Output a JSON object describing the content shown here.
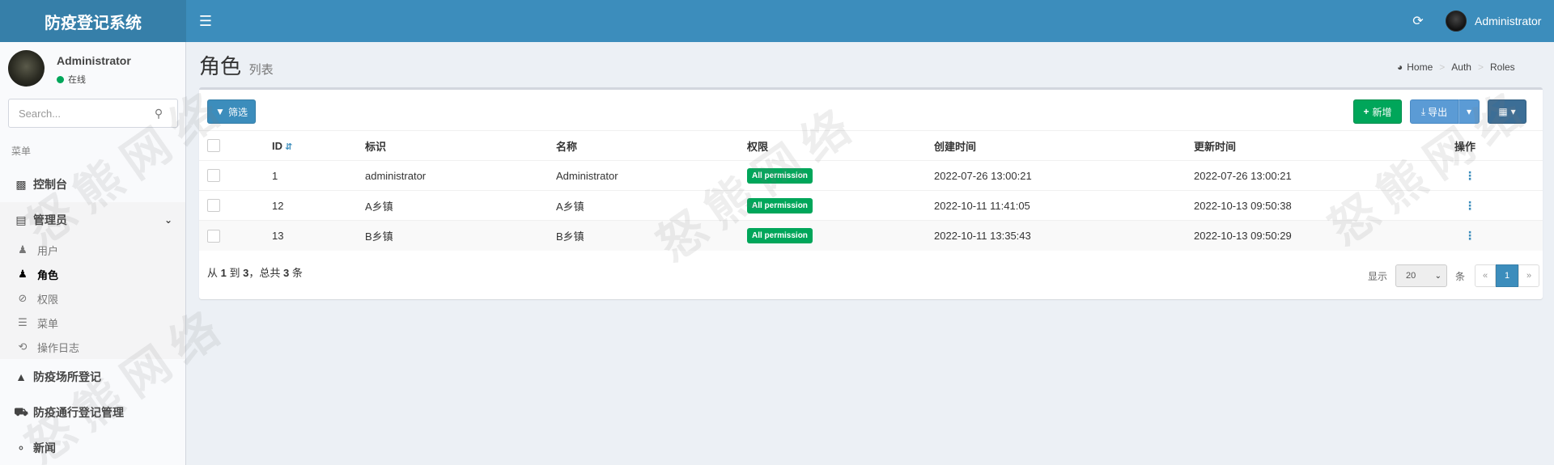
{
  "header": {
    "app_title": "防疫登记系统",
    "user_name": "Administrator",
    "menu_icon": "hamburger-icon",
    "refresh_icon": "refresh-icon"
  },
  "sidebar": {
    "user_name": "Administrator",
    "status": "在线",
    "search_placeholder": "Search...",
    "menu_header": "菜单",
    "items": [
      {
        "label": "控制台",
        "icon": "bar-chart-icon"
      },
      {
        "label": "管理员",
        "icon": "server-icon",
        "expanded": true
      },
      {
        "label": "防疫场所登记",
        "icon": "area-chart-icon"
      },
      {
        "label": "防疫通行登记管理",
        "icon": "car-icon"
      },
      {
        "label": "新闻",
        "icon": "bell-icon"
      }
    ],
    "sub_items": [
      {
        "label": "用户",
        "icon": "users-icon"
      },
      {
        "label": "角色",
        "icon": "user-icon",
        "active": true
      },
      {
        "label": "权限",
        "icon": "ban-icon"
      },
      {
        "label": "菜单",
        "icon": "bars-icon"
      },
      {
        "label": "操作日志",
        "icon": "history-icon"
      }
    ]
  },
  "page": {
    "title": "角色",
    "subtitle": "列表",
    "breadcrumb": [
      "Home",
      "Auth",
      "Roles"
    ]
  },
  "toolbar": {
    "filter_label": "筛选",
    "new_label": "新增",
    "export_label": "导出"
  },
  "table": {
    "columns": [
      "ID",
      "标识",
      "名称",
      "权限",
      "创建时间",
      "更新时间",
      "操作"
    ],
    "rows": [
      {
        "id": "1",
        "slug": "administrator",
        "name": "Administrator",
        "permission": "All permission",
        "created": "2022-07-26 13:00:21",
        "updated": "2022-07-26 13:00:21"
      },
      {
        "id": "12",
        "slug": "A乡镇",
        "name": "A乡镇",
        "permission": "All permission",
        "created": "2022-10-11 11:41:05",
        "updated": "2022-10-13 09:50:38"
      },
      {
        "id": "13",
        "slug": "B乡镇",
        "name": "B乡镇",
        "permission": "All permission",
        "created": "2022-10-11 13:35:43",
        "updated": "2022-10-13 09:50:29"
      }
    ]
  },
  "footer": {
    "summary_prefix": "从",
    "summary_from": "1",
    "summary_to_word": "到",
    "summary_to": "3",
    "summary_total_word": "，总共",
    "summary_total": "3",
    "summary_suffix": "条",
    "show_label": "显示",
    "per_page": "20",
    "per_page_unit": "条",
    "prev": "«",
    "current_page": "1",
    "next": "»"
  },
  "watermark": "怒熊网络",
  "colors": {
    "header": "#3c8dbc",
    "logo_bg": "#367fa9",
    "success": "#00a65a",
    "primary": "#3c8dbc"
  }
}
